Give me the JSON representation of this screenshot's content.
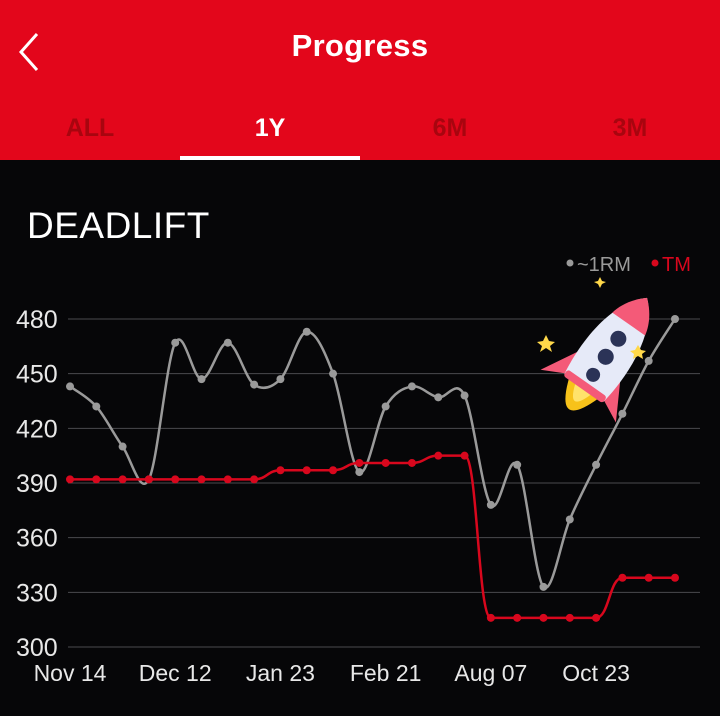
{
  "header": {
    "title": "Progress",
    "back_icon": "chevron-left-icon",
    "background": "#e3061b"
  },
  "tabs": [
    {
      "label": "ALL",
      "active": false
    },
    {
      "label": "1Y",
      "active": true
    },
    {
      "label": "6M",
      "active": false
    },
    {
      "label": "3M",
      "active": false
    }
  ],
  "chart_title": "DEADLIFT",
  "decoration": {
    "icon": "rocket-icon"
  },
  "chart_data": {
    "type": "line",
    "title": "DEADLIFT",
    "xlabel": "",
    "ylabel": "",
    "ylim": [
      300,
      480
    ],
    "yticks": [
      300,
      330,
      360,
      390,
      420,
      450,
      480
    ],
    "xtick_labels": [
      "Nov 14",
      "Dec 12",
      "Jan 23",
      "Feb 21",
      "Aug 07",
      "Oct 23"
    ],
    "xtick_index": [
      0,
      4,
      8,
      12,
      16,
      20
    ],
    "grid": true,
    "legend_position": "top-right",
    "series": [
      {
        "name": "~1RM",
        "color": "#9a9a9a",
        "values": [
          443,
          432,
          410,
          392,
          467,
          447,
          467,
          444,
          447,
          473,
          450,
          396,
          432,
          443,
          437,
          438,
          378,
          400,
          333,
          370,
          400,
          428,
          457,
          480
        ]
      },
      {
        "name": "TM",
        "color": "#d8071d",
        "values": [
          392,
          392,
          392,
          392,
          392,
          392,
          392,
          392,
          397,
          397,
          397,
          401,
          401,
          401,
          405,
          405,
          316,
          316,
          316,
          316,
          316,
          338,
          338,
          338
        ]
      }
    ]
  }
}
